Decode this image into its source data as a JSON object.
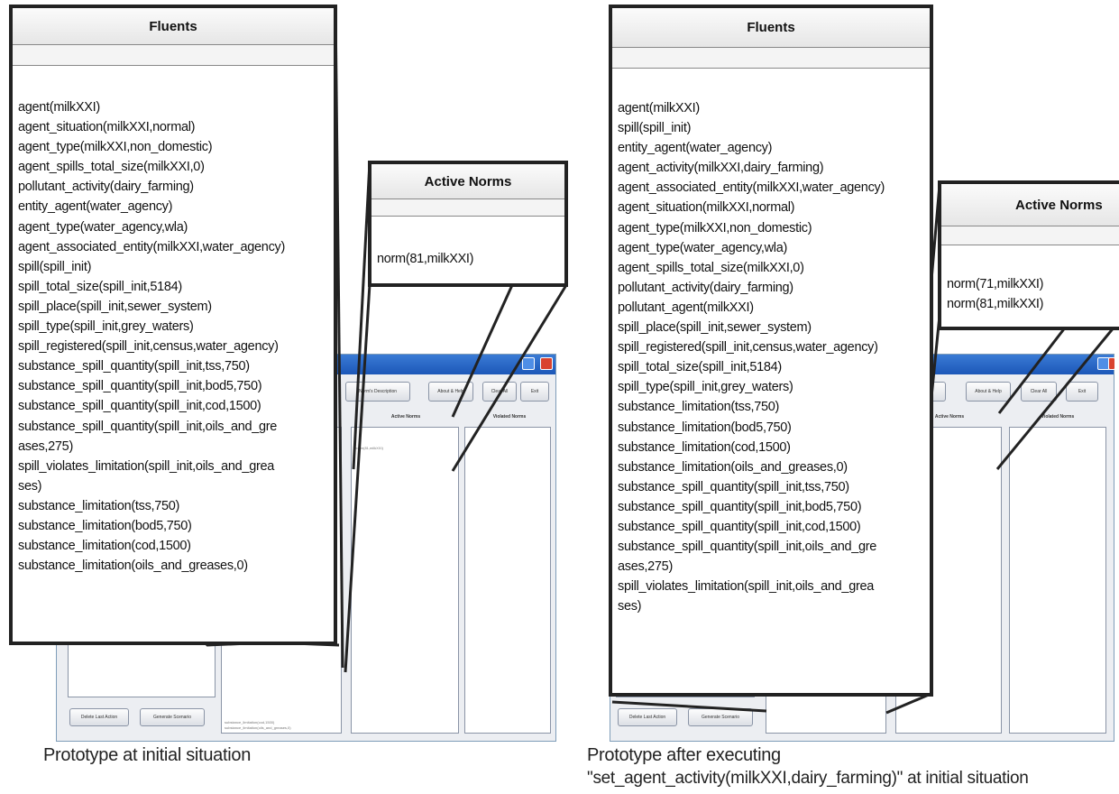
{
  "app": {
    "buttons": {
      "norm_description": "Norm's Description",
      "about_help": "About & Help",
      "clear_all": "Clear All",
      "exit": "Exit",
      "delete_last_action": "Delete Last Action",
      "generate_scenario": "Generate Scenario"
    },
    "columns": {
      "active_norms": "Active Norms",
      "violated_norms": "Violated Norms"
    }
  },
  "left": {
    "fluents_title": "Fluents",
    "fluents": [
      "agent(milkXXI)",
      "agent_situation(milkXXI,normal)",
      "agent_type(milkXXI,non_domestic)",
      "agent_spills_total_size(milkXXI,0)",
      "pollutant_activity(dairy_farming)",
      "entity_agent(water_agency)",
      "agent_type(water_agency,wla)",
      "agent_associated_entity(milkXXI,water_agency)",
      "spill(spill_init)",
      "spill_total_size(spill_init,5184)",
      "spill_place(spill_init,sewer_system)",
      "spill_type(spill_init,grey_waters)",
      "spill_registered(spill_init,census,water_agency)",
      "substance_spill_quantity(spill_init,tss,750)",
      "substance_spill_quantity(spill_init,bod5,750)",
      "substance_spill_quantity(spill_init,cod,1500)",
      "substance_spill_quantity(spill_init,oils_and_gre",
      "ases,275)",
      "spill_violates_limitation(spill_init,oils_and_grea",
      "ses)",
      "substance_limitation(tss,750)",
      "substance_limitation(bod5,750)",
      "substance_limitation(cod,1500)",
      "substance_limitation(oils_and_greases,0)"
    ],
    "norms_title": "Active Norms",
    "norms": [
      "norm(81,milkXXI)"
    ],
    "bg_active_norm": "norm(81,milkXXI)",
    "bg_fluent_tail": [
      "substance_limitation(cod,1500)",
      "substance_limitation(oils_and_greases,0)"
    ],
    "caption_lines": [
      "Prototype at initial situation"
    ]
  },
  "right": {
    "fluents_title": "Fluents",
    "fluents": [
      "agent(milkXXI)",
      "spill(spill_init)",
      "entity_agent(water_agency)",
      "agent_activity(milkXXI,dairy_farming)",
      "agent_associated_entity(milkXXI,water_agency)",
      "agent_situation(milkXXI,normal)",
      "agent_type(milkXXI,non_domestic)",
      "agent_type(water_agency,wla)",
      "agent_spills_total_size(milkXXI,0)",
      "pollutant_activity(dairy_farming)",
      "pollutant_agent(milkXXI)",
      "spill_place(spill_init,sewer_system)",
      "spill_registered(spill_init,census,water_agency)",
      "spill_total_size(spill_init,5184)",
      "spill_type(spill_init,grey_waters)",
      "substance_limitation(tss,750)",
      "substance_limitation(bod5,750)",
      "substance_limitation(cod,1500)",
      "substance_limitation(oils_and_greases,0)",
      "substance_spill_quantity(spill_init,tss,750)",
      "substance_spill_quantity(spill_init,bod5,750)",
      "substance_spill_quantity(spill_init,cod,1500)",
      "substance_spill_quantity(spill_init,oils_and_gre",
      "ases,275)",
      "spill_violates_limitation(spill_init,oils_and_grea",
      "ses)"
    ],
    "norms_title": "Active Norms",
    "norms": [
      "norm(71,milkXXI)",
      "norm(81,milkXXI)"
    ],
    "caption_lines": [
      "Prototype after executing",
      "\"set_agent_activity(milkXXI,dairy_farming)\" at initial situation"
    ]
  }
}
